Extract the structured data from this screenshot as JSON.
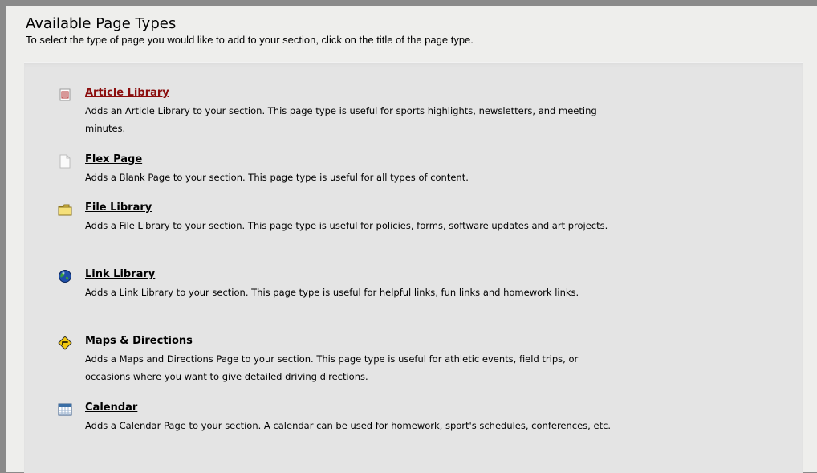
{
  "header": {
    "title": "Available Page Types",
    "subtitle": "To select the type of page you would like to add to your section, click on the title of the page type."
  },
  "page_types": [
    {
      "icon": "article-library-icon",
      "title": "Article Library",
      "description": "Adds an Article Library to your section. This page type is useful for sports highlights, newsletters, and meeting minutes."
    },
    {
      "icon": "blank-page-icon",
      "title": "Flex Page",
      "description": "Adds a Blank Page to your section. This page type is useful for all types of content."
    },
    {
      "icon": "folder-icon",
      "title": "File Library",
      "description": "Adds a File Library to your section. This page type is useful for policies, forms, software updates and art projects."
    },
    {
      "icon": "globe-icon",
      "title": "Link Library",
      "description": "Adds a Link Library to your section. This page type is useful for helpful links, fun links and homework links."
    },
    {
      "icon": "road-sign-icon",
      "title": "Maps & Directions",
      "description": "Adds a Maps and Directions Page to your section. This page type is useful for athletic events, field trips, or occasions where you want to give detailed driving directions."
    },
    {
      "icon": "calendar-icon",
      "title": "Calendar",
      "description": "Adds a Calendar Page to your section. A calendar can be used for homework, sport's schedules, conferences, etc."
    }
  ],
  "colors": {
    "active_link": "#8b0d0d",
    "link": "#000000",
    "panel": "#e4e4e4",
    "background": "#eeeeec"
  }
}
